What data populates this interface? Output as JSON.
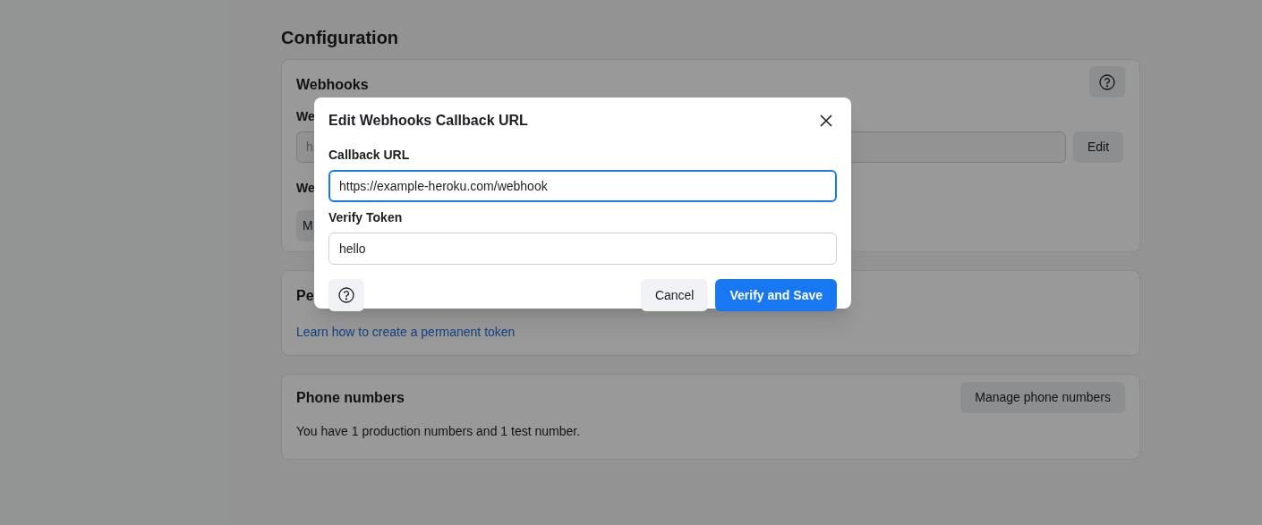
{
  "page": {
    "title": "Configuration"
  },
  "webhooks_card": {
    "title": "Webhooks",
    "field_label": "We",
    "field_value": "h",
    "edit_button": "Edit",
    "second_label": "We",
    "button": "M"
  },
  "permanent_card": {
    "title": "Pe",
    "link": "Learn how to create a permanent token"
  },
  "phone_card": {
    "title": "Phone numbers",
    "button": "Manage phone numbers",
    "text": "You have 1 production numbers and 1 test number."
  },
  "dialog": {
    "title": "Edit Webhooks Callback URL",
    "fields": [
      {
        "label": "Callback URL",
        "value": "https://example-heroku.com/webhook",
        "focused": true
      },
      {
        "label": "Verify Token",
        "value": "hello",
        "focused": false
      }
    ],
    "buttons": [
      {
        "label": "Cancel",
        "kind": "secondary"
      },
      {
        "label": "Verify and Save",
        "kind": "primary"
      }
    ]
  }
}
